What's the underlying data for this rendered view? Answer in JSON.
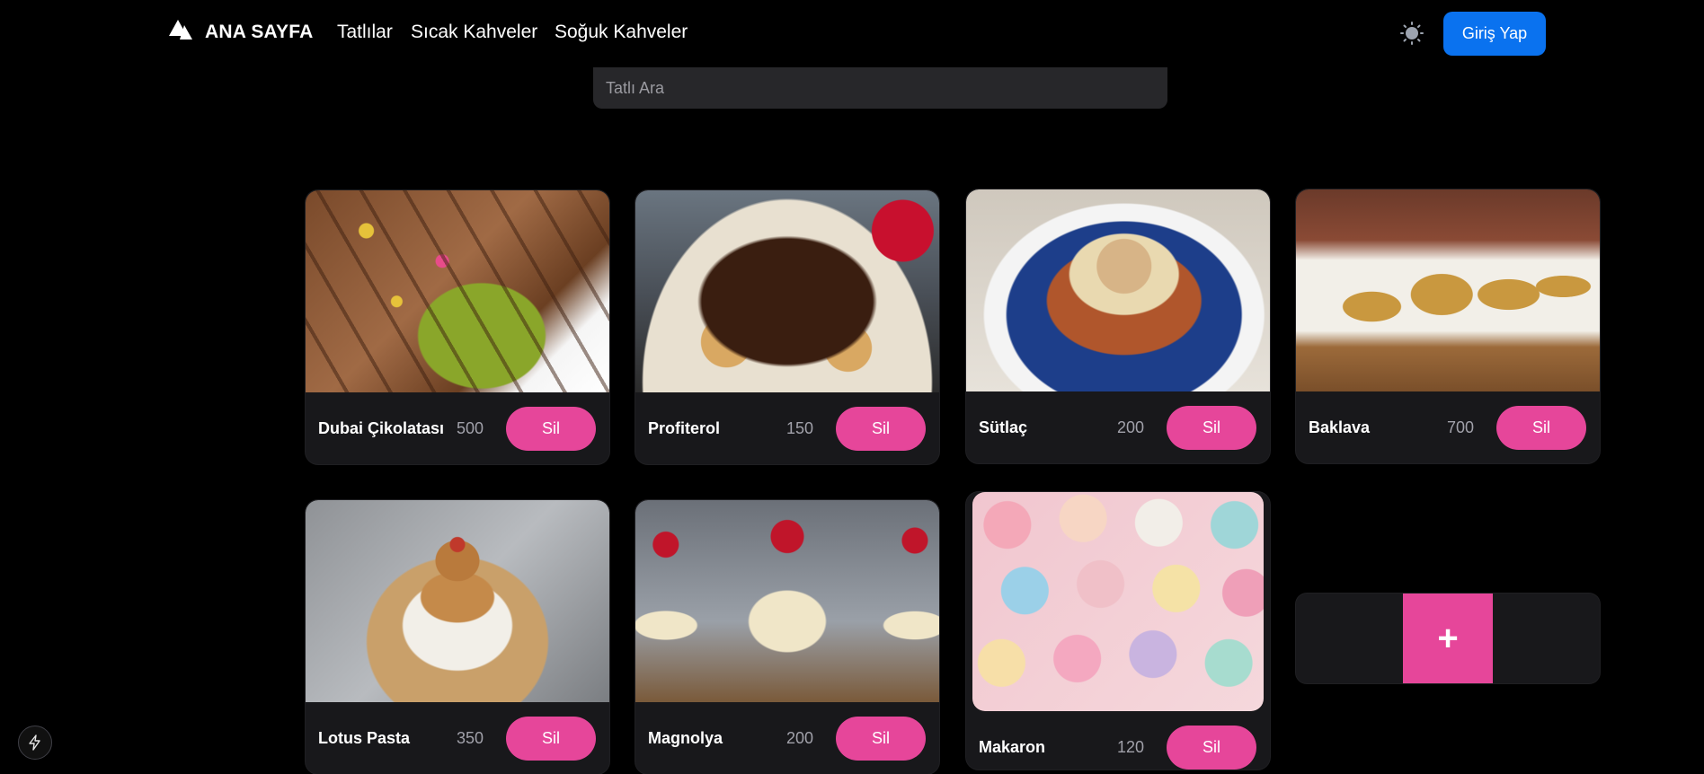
{
  "nav": {
    "brand": "ANA SAYFA",
    "links": [
      "Tatlılar",
      "Sıcak Kahveler",
      "Soğuk Kahveler"
    ],
    "login_label": "Giriş Yap",
    "brand_icon": "triangle-logo-icon",
    "theme_icon": "sun-icon"
  },
  "search": {
    "placeholder": "Tatlı Ara"
  },
  "products": [
    {
      "name": "Dubai Çikolatası",
      "price": "500",
      "action": "Sil",
      "image": "chocolate-bar-image"
    },
    {
      "name": "Profiterol",
      "price": "150",
      "action": "Sil",
      "image": "profiterole-image"
    },
    {
      "name": "Sütlaç",
      "price": "200",
      "action": "Sil",
      "image": "rice-pudding-image"
    },
    {
      "name": "Baklava",
      "price": "700",
      "action": "Sil",
      "image": "baklava-image"
    },
    {
      "name": "Lotus Pasta",
      "price": "350",
      "action": "Sil",
      "image": "lotus-cake-image"
    },
    {
      "name": "Magnolya",
      "price": "200",
      "action": "Sil",
      "image": "magnolia-dessert-image"
    },
    {
      "name": "Makaron",
      "price": "120",
      "action": "Sil",
      "image": "macaron-image"
    }
  ],
  "add_button": "+",
  "colors": {
    "accent": "#e6469a",
    "primary": "#0a72ef",
    "card": "#18181b",
    "background": "#000000"
  }
}
